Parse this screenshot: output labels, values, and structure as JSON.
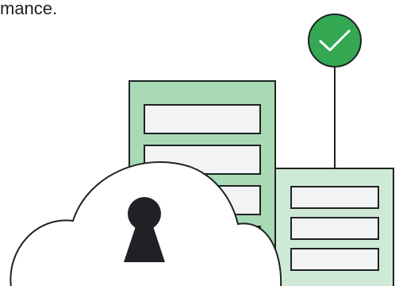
{
  "caption": {
    "text": "mance."
  },
  "illustration": {
    "status": "verified",
    "icons": {
      "check": "check-icon",
      "lock": "keyhole-lock-icon",
      "cloud": "cloud-icon",
      "server": "server-rack-icon"
    },
    "colors": {
      "outline": "#202124",
      "server_tall": "#a8dab5",
      "server_short": "#ceead6",
      "slot_fill": "#f1f3f4",
      "badge": "#34a853",
      "cloud_fill": "#ffffff"
    }
  }
}
